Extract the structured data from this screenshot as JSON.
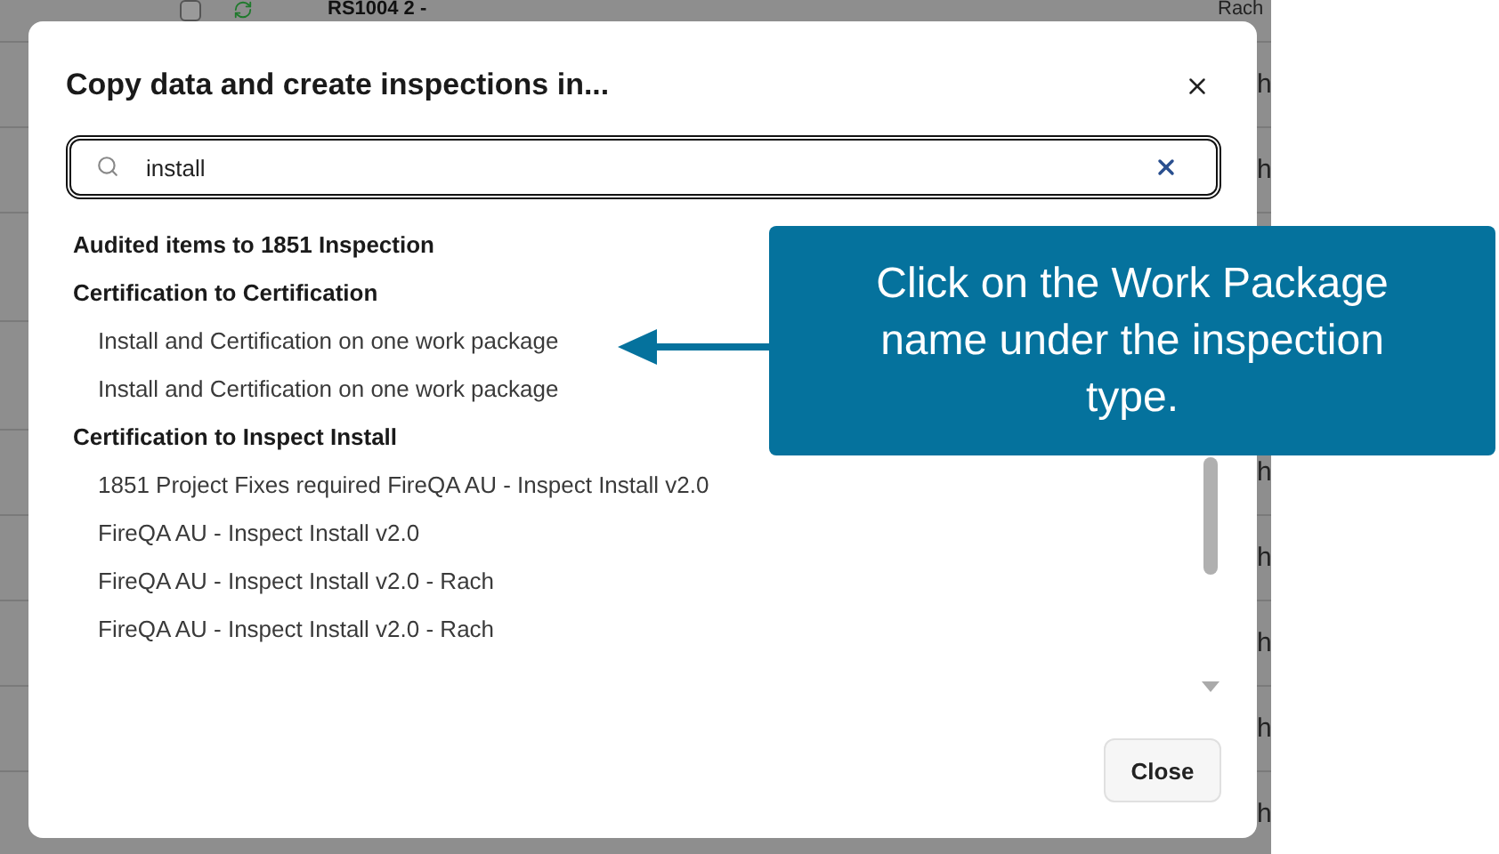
{
  "background_table": {
    "rows": [
      {
        "kind": "full",
        "checked": false,
        "name": "RS1004 2 -",
        "owner": "Rach"
      },
      {
        "kind": "cut",
        "owner": "h"
      },
      {
        "kind": "cut",
        "owner": "h"
      },
      {
        "kind": "hidden"
      },
      {
        "kind": "hidden"
      },
      {
        "kind": "cut",
        "owner": "h"
      },
      {
        "kind": "cut",
        "owner": "h"
      },
      {
        "kind": "cut",
        "owner": "h"
      },
      {
        "kind": "cut",
        "owner": "h"
      },
      {
        "kind": "cut",
        "owner": "h"
      }
    ]
  },
  "dialog": {
    "title": "Copy data and create inspections in...",
    "search": {
      "value": "install"
    },
    "groups": [
      {
        "heading": "Audited items to 1851 Inspection"
      },
      {
        "heading": "Certification to Certification",
        "items": [
          "Install and Certification on one work package",
          "Install and Certification on one work package"
        ]
      },
      {
        "heading": "Certification to Inspect Install",
        "items": [
          "1851 Project Fixes required FireQA AU - Inspect Install v2.0",
          "FireQA AU - Inspect Install v2.0",
          "FireQA AU - Inspect Install v2.0 - Rach",
          "FireQA AU - Inspect Install v2.0 - Rach"
        ]
      }
    ],
    "close_button": "Close"
  },
  "callout": {
    "text": "Click on the Work Package name under the inspection type."
  }
}
